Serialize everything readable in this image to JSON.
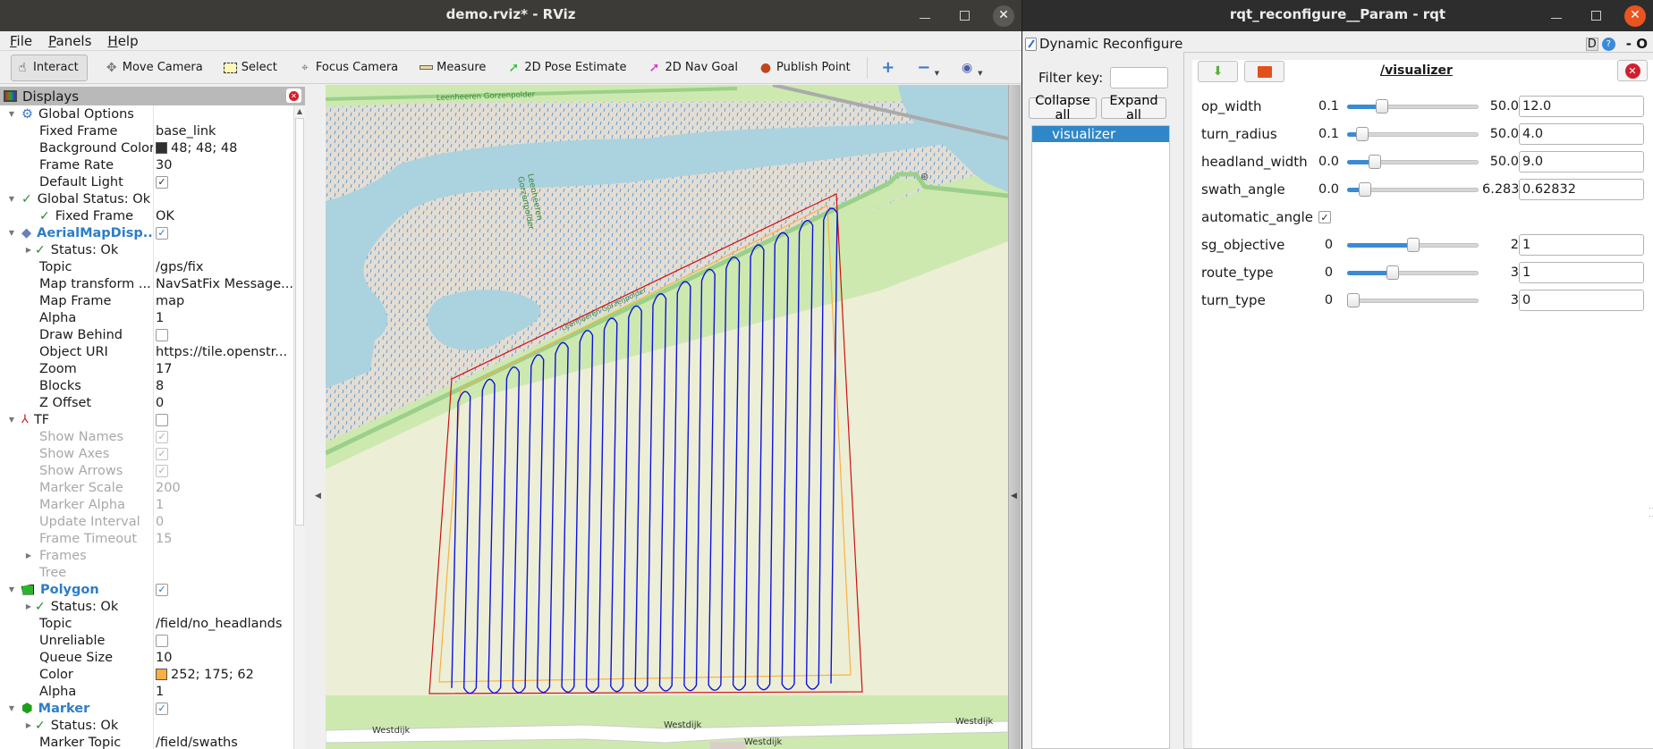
{
  "rviz": {
    "title": "demo.rviz* - RViz",
    "menu": [
      {
        "label": "File",
        "u": "F",
        "rest": "ile"
      },
      {
        "label": "Panels",
        "u": "P",
        "rest": "anels"
      },
      {
        "label": "Help",
        "u": "H",
        "rest": "elp"
      }
    ],
    "toolbar": {
      "interact": "Interact",
      "move_camera": "Move Camera",
      "select": "Select",
      "focus_camera": "Focus Camera",
      "measure": "Measure",
      "pose_estimate": "2D Pose Estimate",
      "nav_goal": "2D Nav Goal",
      "publish_point": "Publish Point"
    },
    "displays": {
      "title": "Displays",
      "global_options": {
        "label": "Global Options",
        "fixed_frame": {
          "k": "Fixed Frame",
          "v": "base_link"
        },
        "background_color": {
          "k": "Background Color",
          "v": "48; 48; 48",
          "color": "#303030"
        },
        "frame_rate": {
          "k": "Frame Rate",
          "v": "30"
        },
        "default_light": {
          "k": "Default Light",
          "checked": true
        }
      },
      "global_status": {
        "label": "Global Status: Ok",
        "fixed_frame": {
          "k": "Fixed Frame",
          "v": "OK"
        }
      },
      "aerial": {
        "label": "AerialMapDisp...",
        "checked": true,
        "status": "Status: Ok",
        "topic": {
          "k": "Topic",
          "v": "/gps/fix"
        },
        "map_transform": {
          "k": "Map transform ...",
          "v": "NavSatFix Message..."
        },
        "map_frame": {
          "k": "Map Frame",
          "v": "map"
        },
        "alpha": {
          "k": "Alpha",
          "v": "1"
        },
        "draw_behind": {
          "k": "Draw Behind",
          "checked": false
        },
        "object_uri": {
          "k": "Object URI",
          "v": "https://tile.openstr..."
        },
        "zoom": {
          "k": "Zoom",
          "v": "17"
        },
        "blocks": {
          "k": "Blocks",
          "v": "8"
        },
        "z_offset": {
          "k": "Z Offset",
          "v": "0"
        }
      },
      "tf": {
        "label": "TF",
        "checked": false,
        "show_names": {
          "k": "Show Names",
          "checked": true
        },
        "show_axes": {
          "k": "Show Axes",
          "checked": true
        },
        "show_arrows": {
          "k": "Show Arrows",
          "checked": true
        },
        "marker_scale": {
          "k": "Marker Scale",
          "v": "200"
        },
        "marker_alpha": {
          "k": "Marker Alpha",
          "v": "1"
        },
        "update_interval": {
          "k": "Update Interval",
          "v": "0"
        },
        "frame_timeout": {
          "k": "Frame Timeout",
          "v": "15"
        },
        "frames": "Frames",
        "tree": "Tree"
      },
      "polygon": {
        "label": "Polygon",
        "checked": true,
        "status": "Status: Ok",
        "topic": {
          "k": "Topic",
          "v": "/field/no_headlands"
        },
        "unreliable": {
          "k": "Unreliable",
          "checked": false
        },
        "queue_size": {
          "k": "Queue Size",
          "v": "10"
        },
        "color": {
          "k": "Color",
          "v": "252; 175; 62",
          "color": "#fcaf3e"
        },
        "alpha": {
          "k": "Alpha",
          "v": "1"
        }
      },
      "marker": {
        "label": "Marker",
        "checked": true,
        "status": "Status: Ok",
        "marker_topic": {
          "k": "Marker Topic",
          "v": "/field/swaths"
        }
      }
    },
    "map_labels": {
      "polder_top": "Leenheeren Gorzenpolder",
      "polder_center_1": "Leenheeren",
      "polder_center_2": "Gorzenpolder",
      "dike": "Leenheeren Gorzenpolder",
      "road": "Westdijk"
    },
    "colors": {
      "outer_polygon": "#d01010",
      "headland_polygon": "#fcaf3e",
      "swaths": "#1010e0"
    }
  },
  "rqt": {
    "title": "rqt_reconfigure__Param - rqt",
    "plugin_title": "Dynamic Reconfigure",
    "d_label": "D",
    "help_label": "?",
    "dash_o": "- O",
    "filter_label": "Filter key:",
    "filter_value": "",
    "collapse_all": "Collapse all",
    "expand_all": "Expand all",
    "nodes": [
      "visualizer"
    ],
    "node_title": "/visualizer",
    "params": [
      {
        "name": "op_width",
        "min": "0.1",
        "max": "50.0",
        "value": "12.0",
        "fraction": 0.238
      },
      {
        "name": "turn_radius",
        "min": "0.1",
        "max": "50.0",
        "value": "4.0",
        "fraction": 0.078
      },
      {
        "name": "headland_width",
        "min": "0.0",
        "max": "50.0",
        "value": "9.0",
        "fraction": 0.18
      },
      {
        "name": "swath_angle",
        "min": "0.0",
        "max": "6.2832",
        "value": "0.62832",
        "fraction": 0.1
      },
      {
        "name": "automatic_angle",
        "checked": true
      },
      {
        "name": "sg_objective",
        "min": "0",
        "max": "2",
        "value": "1",
        "fraction": 0.5
      },
      {
        "name": "route_type",
        "min": "0",
        "max": "3",
        "value": "1",
        "fraction": 0.333
      },
      {
        "name": "turn_type",
        "min": "0",
        "max": "3",
        "value": "0",
        "fraction": 0.0
      }
    ]
  }
}
